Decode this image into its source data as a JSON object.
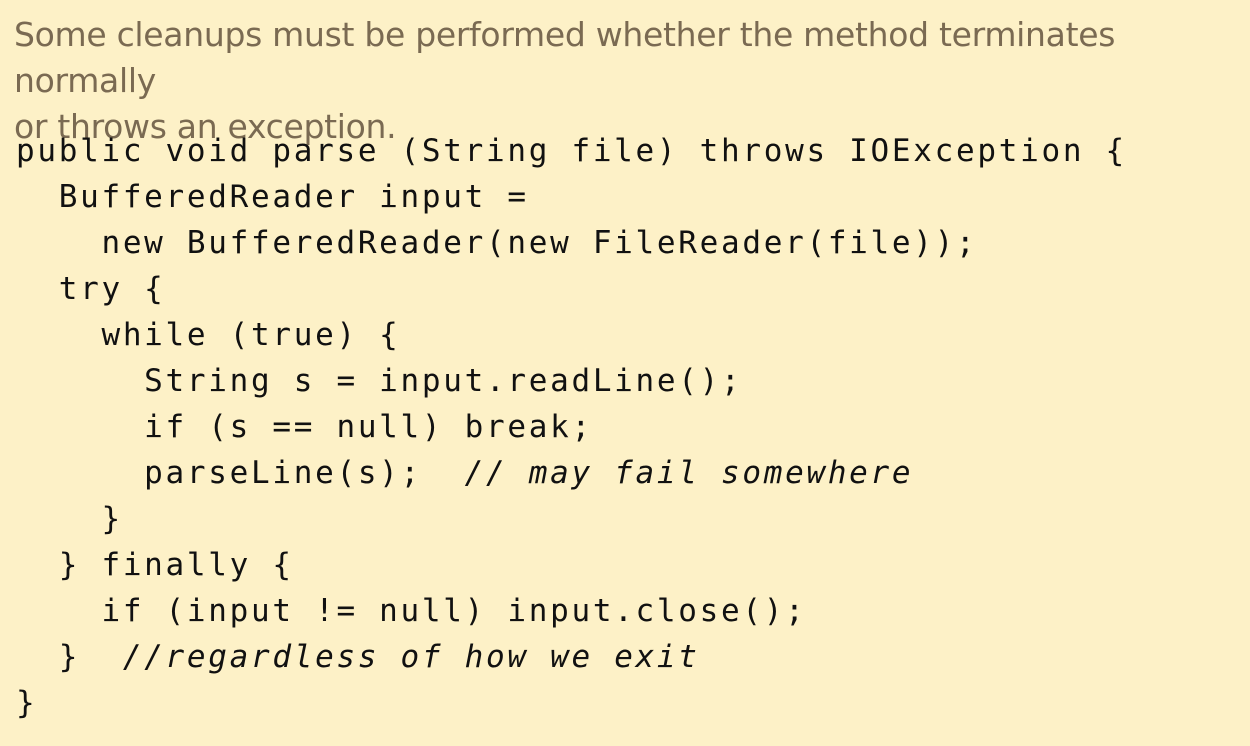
{
  "intro": {
    "line1": "Some cleanups must be performed whether the method terminates normally",
    "line2": "or throws an exception."
  },
  "code": {
    "lines": [
      {
        "code": "public void parse (String file) throws IOException {",
        "comment": ""
      },
      {
        "code": "  BufferedReader input =",
        "comment": ""
      },
      {
        "code": "    new BufferedReader(new FileReader(file));",
        "comment": ""
      },
      {
        "code": "  try {",
        "comment": ""
      },
      {
        "code": "    while (true) {",
        "comment": ""
      },
      {
        "code": "      String s = input.readLine();",
        "comment": ""
      },
      {
        "code": "      if (s == null) break;",
        "comment": ""
      },
      {
        "code": "      parseLine(s);  ",
        "comment": "// may fail somewhere"
      },
      {
        "code": "    }",
        "comment": ""
      },
      {
        "code": "  } finally {",
        "comment": ""
      },
      {
        "code": "    if (input != null) input.close();",
        "comment": ""
      },
      {
        "code": "  }  ",
        "comment": "//regardless of how we exit"
      },
      {
        "code": "}",
        "comment": ""
      }
    ]
  }
}
